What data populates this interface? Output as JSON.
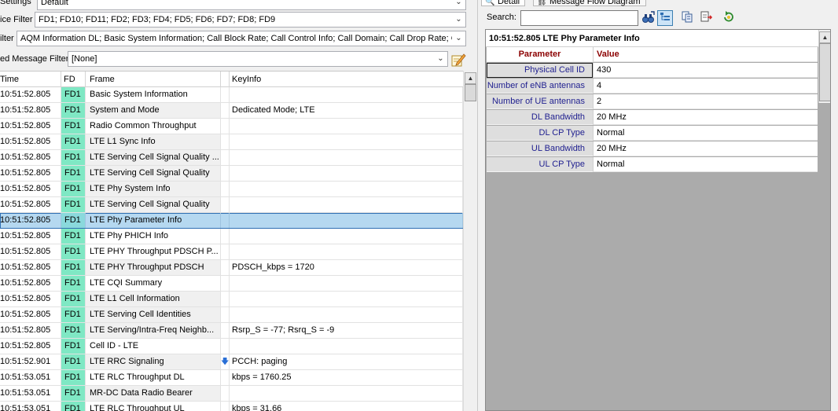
{
  "filters": {
    "settings_label": "Settings",
    "settings_value": "Default",
    "device_label": "ice Filter",
    "device_value": "FD1; FD10; FD11; FD2; FD3; FD4; FD5; FD6; FD7; FD8; FD9",
    "message_label": "ilter",
    "message_value": "AQM Information DL; Basic System Information; Call Block Rate; Call Control Info; Call Domain; Call Drop Rate; Cal",
    "saved_label": "ed Message Filter",
    "saved_value": "[None]"
  },
  "grid": {
    "headers": {
      "time": "Time",
      "fd": "FD",
      "frame": "Frame",
      "keyinfo": "KeyInfo"
    },
    "rows": [
      {
        "time": "10:51:52.805",
        "fd": "FD1",
        "frame": "Basic System Information",
        "flag": "",
        "keyinfo": ""
      },
      {
        "time": "10:51:52.805",
        "fd": "FD1",
        "frame": "System and Mode",
        "flag": "",
        "keyinfo": "Dedicated Mode;  LTE"
      },
      {
        "time": "10:51:52.805",
        "fd": "FD1",
        "frame": "Radio Common Throughput",
        "flag": "",
        "keyinfo": ""
      },
      {
        "time": "10:51:52.805",
        "fd": "FD1",
        "frame": "LTE L1 Sync Info",
        "flag": "",
        "keyinfo": ""
      },
      {
        "time": "10:51:52.805",
        "fd": "FD1",
        "frame": "LTE Serving Cell Signal Quality ...",
        "flag": "",
        "keyinfo": ""
      },
      {
        "time": "10:51:52.805",
        "fd": "FD1",
        "frame": "LTE Serving Cell Signal Quality",
        "flag": "",
        "keyinfo": ""
      },
      {
        "time": "10:51:52.805",
        "fd": "FD1",
        "frame": "LTE Phy System Info",
        "flag": "",
        "keyinfo": ""
      },
      {
        "time": "10:51:52.805",
        "fd": "FD1",
        "frame": "LTE Serving Cell Signal Quality",
        "flag": "",
        "keyinfo": ""
      },
      {
        "time": "10:51:52.805",
        "fd": "FD1",
        "frame": "LTE Phy Parameter Info",
        "flag": "",
        "keyinfo": ""
      },
      {
        "time": "10:51:52.805",
        "fd": "FD1",
        "frame": "LTE Phy PHICH Info",
        "flag": "",
        "keyinfo": ""
      },
      {
        "time": "10:51:52.805",
        "fd": "FD1",
        "frame": "LTE PHY Throughput PDSCH P...",
        "flag": "",
        "keyinfo": ""
      },
      {
        "time": "10:51:52.805",
        "fd": "FD1",
        "frame": "LTE PHY Throughput PDSCH",
        "flag": "",
        "keyinfo": "PDSCH_kbps = 1720"
      },
      {
        "time": "10:51:52.805",
        "fd": "FD1",
        "frame": "LTE CQI Summary",
        "flag": "",
        "keyinfo": ""
      },
      {
        "time": "10:51:52.805",
        "fd": "FD1",
        "frame": "LTE L1 Cell Information",
        "flag": "",
        "keyinfo": ""
      },
      {
        "time": "10:51:52.805",
        "fd": "FD1",
        "frame": "LTE Serving Cell Identities",
        "flag": "",
        "keyinfo": ""
      },
      {
        "time": "10:51:52.805",
        "fd": "FD1",
        "frame": "LTE Serving/Intra-Freq Neighb...",
        "flag": "",
        "keyinfo": "Rsrp_S = -77;  Rsrq_S = -9"
      },
      {
        "time": "10:51:52.805",
        "fd": "FD1",
        "frame": "Cell ID - LTE",
        "flag": "",
        "keyinfo": ""
      },
      {
        "time": "10:51:52.901",
        "fd": "FD1",
        "frame": "LTE RRC Signaling",
        "flag": "🡇",
        "keyinfo": "PCCH: paging"
      },
      {
        "time": "10:51:53.051",
        "fd": "FD1",
        "frame": "LTE RLC Throughput DL",
        "flag": "",
        "keyinfo": "kbps = 1760.25"
      },
      {
        "time": "10:51:53.051",
        "fd": "FD1",
        "frame": "MR-DC Data Radio Bearer",
        "flag": "",
        "keyinfo": ""
      },
      {
        "time": "10:51:53.051",
        "fd": "FD1",
        "frame": "LTE RLC Throughput UL",
        "flag": "",
        "keyinfo": "kbps = 31.66"
      }
    ]
  },
  "right": {
    "tab_detail": "Detail",
    "tab_flow": "Message Flow Diagram",
    "search_label": "Search:",
    "search_value": "",
    "detail_title": "10:51:52.805 LTE Phy Parameter Info",
    "param_header": "Parameter",
    "value_header": "Value",
    "params": [
      {
        "name": "Physical Cell ID",
        "value": "430"
      },
      {
        "name": "Number of eNB antennas",
        "value": "4"
      },
      {
        "name": "Number of UE antennas",
        "value": "2"
      },
      {
        "name": "DL Bandwidth",
        "value": "20 MHz"
      },
      {
        "name": "DL CP Type",
        "value": "Normal"
      },
      {
        "name": "UL Bandwidth",
        "value": "20 MHz"
      },
      {
        "name": "UL CP Type",
        "value": "Normal"
      }
    ]
  },
  "colors": {
    "fd_cell": "#7fe8c4",
    "selected_row": "#b5d8f0",
    "param_header": "#8b0000",
    "param_name": "#1f1f8f"
  }
}
